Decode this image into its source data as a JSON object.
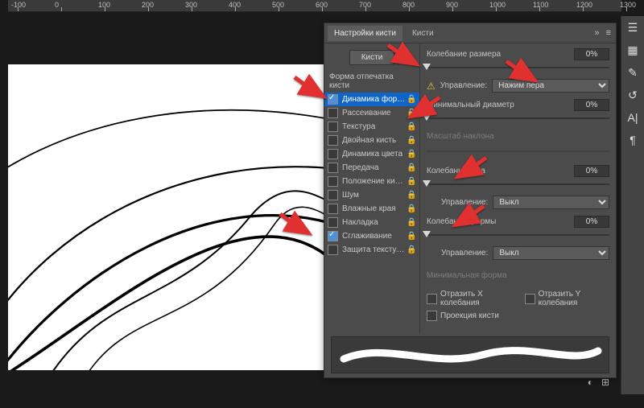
{
  "ruler_marks": [
    "-100",
    "0",
    "100",
    "200",
    "300",
    "400",
    "500",
    "600",
    "700",
    "800",
    "900",
    "1000",
    "1100",
    "1200",
    "1300"
  ],
  "panel": {
    "tab_active": "Настройки кисти",
    "tab_other": "Кисти",
    "brushes_btn": "Кисти",
    "section": "Форма отпечатка кисти",
    "items": [
      {
        "label": "Динамика формы",
        "checked": true,
        "lock": true,
        "selected": true
      },
      {
        "label": "Рассеивание",
        "checked": false,
        "lock": true
      },
      {
        "label": "Текстура",
        "checked": false,
        "lock": true
      },
      {
        "label": "Двойная кисть",
        "checked": false,
        "lock": true
      },
      {
        "label": "Динамика цвета",
        "checked": false,
        "lock": true
      },
      {
        "label": "Передача",
        "checked": false,
        "lock": true
      },
      {
        "label": "Положение кисти",
        "checked": false,
        "lock": true
      },
      {
        "label": "Шум",
        "checked": false,
        "lock": true
      },
      {
        "label": "Влажные края",
        "checked": false,
        "lock": true
      },
      {
        "label": "Накладка",
        "checked": false,
        "lock": true
      },
      {
        "label": "Сглаживание",
        "checked": true,
        "lock": true
      },
      {
        "label": "Защита текстуры",
        "checked": false,
        "lock": true
      }
    ],
    "sizeJitter": {
      "label": "Колебание размера",
      "value": "0%"
    },
    "control_label": "Управление:",
    "control1": "Нажим пера",
    "minDiam": {
      "label": "Минимальный диаметр",
      "value": "0%"
    },
    "tiltScale": "Масштаб наклона",
    "angleJitter": {
      "label": "Колебание угла",
      "value": "0%"
    },
    "control2": "Выкл",
    "roundJitter": {
      "label": "Колебание формы",
      "value": "0%"
    },
    "control3": "Выкл",
    "minRound": "Минимальная форма",
    "flipX": "Отразить X колебания",
    "flipY": "Отразить Y колебания",
    "proj": "Проекция кисти"
  }
}
